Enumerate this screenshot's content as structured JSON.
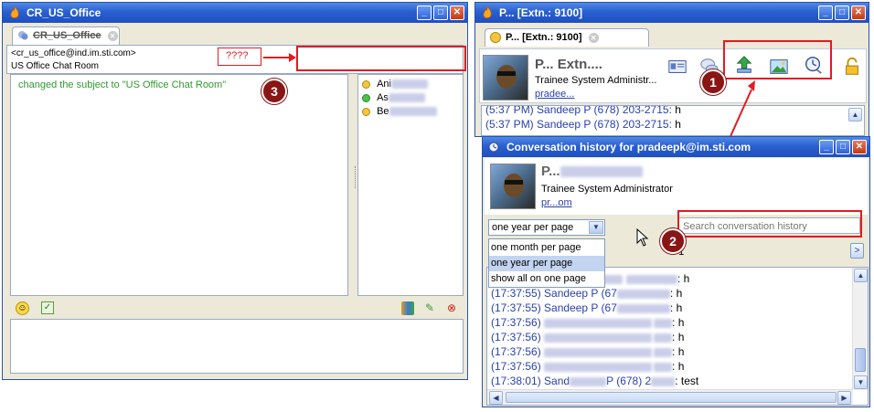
{
  "left_window": {
    "title": "CR_US_Office",
    "tab_label": "CR_US_Office",
    "room_address": "<cr_us_office@ind.im.sti.com>",
    "room_name": "US Office Chat Room",
    "subject_line": "changed the subject to \"US Office Chat Room\"",
    "question_marks": "????",
    "participants": [
      "Ani",
      "As",
      "Be"
    ]
  },
  "right_window": {
    "title": "P... [Extn.: 9100]",
    "tab_label": "P... [Extn.: 9100]",
    "contact_name": "P... Extn....",
    "contact_title": "Trainee System Administr...",
    "contact_email": "pradee...",
    "chat_lines": [
      {
        "stamp": "(5:37 PM) Sandeep P (678) 203-2715:",
        "text": " h"
      },
      {
        "stamp": "(5:37 PM) Sandeep P (678) 203-2715:",
        "text": " h"
      }
    ]
  },
  "history_window": {
    "title": "Conversation history for pradeepk@im.sti.com",
    "contact_name": "P...",
    "contact_title": "Trainee System Administrator",
    "contact_email": "pr...om",
    "page_select_value": "one year per page",
    "page_options": [
      "one month per page",
      "one year per page",
      "show all on one page"
    ],
    "search_placeholder": "Search conversation history",
    "page_indicator": "/ 1",
    "next_button": ">",
    "lines": [
      {
        "stamp": "",
        "name": "",
        "text": "h"
      },
      {
        "stamp": "(17:37:55)",
        "name": "Sandeep P",
        "text": "h"
      },
      {
        "stamp": "(17:37:55)",
        "name": "Sandeep P",
        "text": "h"
      },
      {
        "stamp": "(17:37:56)",
        "name": "",
        "text": "h"
      },
      {
        "stamp": "(17:37:56)",
        "name": "",
        "text": "h"
      },
      {
        "stamp": "(17:37:56)",
        "name": "",
        "text": "h"
      },
      {
        "stamp": "(17:37:56)",
        "name": "",
        "text": "h"
      },
      {
        "stamp": "(17:38:01)",
        "name": "Sand",
        "text": "test"
      }
    ]
  },
  "annotations": {
    "n1": "1",
    "n2": "2",
    "n3": "3"
  },
  "colors": {
    "title_blue": "#2a5fd0",
    "annotation_red": "#e11b22",
    "chat_green": "#2f9a2f",
    "chat_blue": "#2a3fb0"
  }
}
